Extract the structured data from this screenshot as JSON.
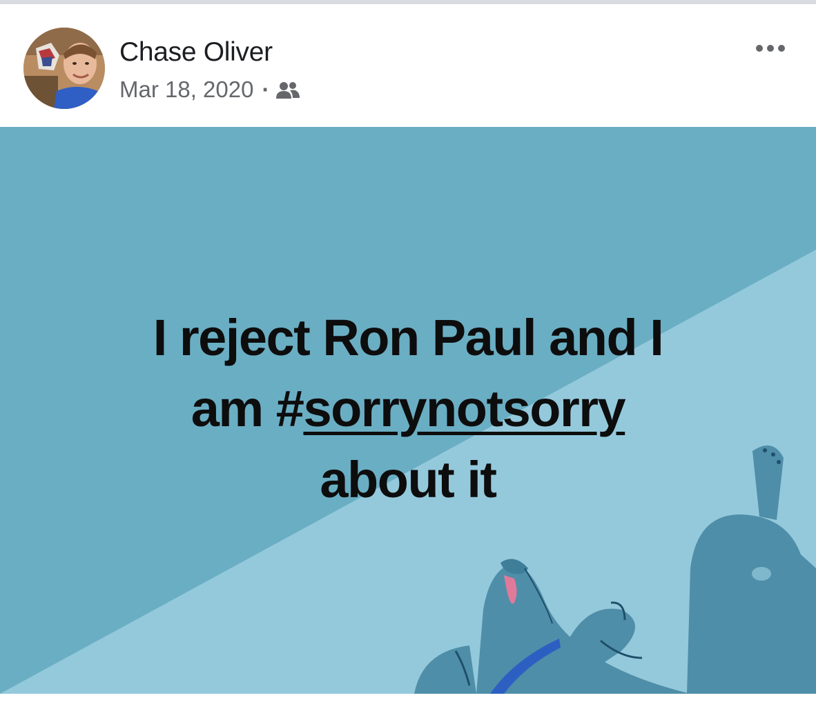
{
  "post": {
    "author_name": "Chase Oliver",
    "date": "Mar 18, 2020",
    "separator": "·",
    "audience_icon": "friends-icon",
    "more_icon": "more-options-icon",
    "avatar_icon": "profile-avatar",
    "text_lines": {
      "line1": "I reject Ron Paul and I",
      "line2_prefix": "am #",
      "line2_hashtag": "sorrynotsorry",
      "line3": "about it"
    },
    "background": {
      "primary_color": "#6aaec3",
      "secondary_color": "#94c9dc",
      "illustration": "dog-lying-on-back"
    }
  }
}
